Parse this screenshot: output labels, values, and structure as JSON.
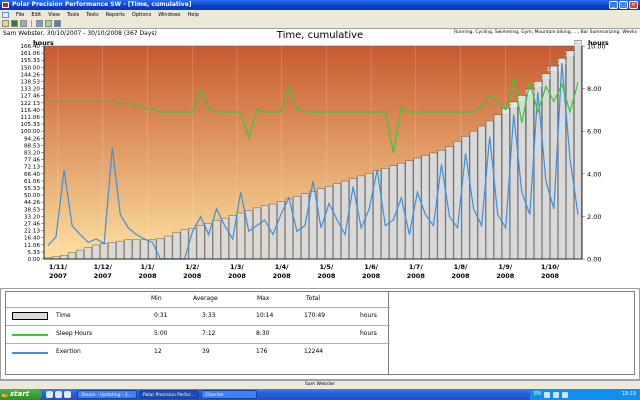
{
  "window": {
    "title": "Polar Precision Performance SW - [Time, cumulative]",
    "controls": [
      "_",
      "□",
      "×"
    ]
  },
  "menu": [
    "File",
    "Edit",
    "View",
    "Tools",
    "Tests",
    "Reports",
    "Options",
    "Windows",
    "Help"
  ],
  "chart_header": {
    "user_range": "Sam Webster, 30/10/2007 - 30/10/2008 (367 Days)",
    "title": "Time, cumulative",
    "sports": "Running, Cycling, Swimming, Gym, Mountain biking, ..., Bar Summarizing: Weeks",
    "left_axis_label": "hours",
    "right_axis_label": "hours"
  },
  "chart_data": {
    "type": "bar",
    "title": "Time, cumulative",
    "left_axis": {
      "label": "hours",
      "ticks": [
        "0.00",
        "5.33",
        "11.06",
        "16.40",
        "22.13",
        "27.46",
        "33.20",
        "38.53",
        "44.26",
        "50.00",
        "55.33",
        "61.06",
        "66.40",
        "72.13",
        "77.46",
        "83.20",
        "88.53",
        "94.26",
        "100.00",
        "105.33",
        "111.06",
        "116.40",
        "122.13",
        "127.46",
        "133.20",
        "138.53",
        "144.26",
        "150.00",
        "155.33",
        "161.06",
        "166.40"
      ],
      "range": [
        0,
        166.67
      ]
    },
    "right_axis": {
      "label": "hours",
      "ticks": [
        "0.00",
        "2.00",
        "4.00",
        "6.00",
        "8.00",
        "10.00"
      ],
      "range": [
        0,
        10
      ]
    },
    "x_ticks": [
      {
        "month": "1/11/",
        "year": "2007"
      },
      {
        "month": "1/12/",
        "year": "2007"
      },
      {
        "month": "1/1/",
        "year": "2008"
      },
      {
        "month": "1/2/",
        "year": "2008"
      },
      {
        "month": "1/3/",
        "year": "2008"
      },
      {
        "month": "1/4/",
        "year": "2008"
      },
      {
        "month": "1/5/",
        "year": "2008"
      },
      {
        "month": "1/6/",
        "year": "2008"
      },
      {
        "month": "1/7/",
        "year": "2008"
      },
      {
        "month": "1/8/",
        "year": "2008"
      },
      {
        "month": "1/9/",
        "year": "2008"
      },
      {
        "month": "1/10/",
        "year": "2008"
      }
    ],
    "series": [
      {
        "name": "Time",
        "unit": "hours",
        "values": [
          1,
          2,
          3,
          5,
          7,
          9,
          11,
          12,
          13,
          14,
          15,
          15,
          15,
          15,
          16,
          18,
          21,
          23,
          24,
          26,
          28,
          30,
          32,
          34,
          36,
          38,
          40,
          42,
          43,
          45,
          47,
          49,
          51,
          53,
          55,
          57,
          59,
          61,
          63,
          65,
          67,
          69,
          71,
          73,
          75,
          77,
          79,
          81,
          83,
          85,
          88,
          92,
          96,
          100,
          104,
          108,
          113,
          118,
          123,
          128,
          133,
          139,
          145,
          151,
          157,
          163,
          171
        ],
        "labels_shown": [
          "98",
          "105",
          "112",
          "120",
          "126",
          "131",
          "143.5",
          "151",
          "162",
          "170"
        ]
      },
      {
        "name": "Sleep Hours",
        "unit": "hours",
        "values": [
          7.4,
          7.4,
          7.4,
          7.4,
          7.4,
          7.4,
          7.4,
          7.4,
          7.4,
          7.3,
          7.3,
          7.2,
          7.1,
          7.0,
          6.9,
          6.9,
          6.9,
          6.9,
          6.9,
          7.9,
          7.1,
          6.9,
          6.9,
          6.9,
          6.9,
          5.7,
          7.0,
          6.9,
          6.9,
          6.9,
          8.1,
          7.0,
          6.9,
          6.9,
          6.9,
          6.9,
          6.9,
          6.9,
          6.9,
          6.9,
          6.9,
          6.9,
          6.9,
          5.0,
          7.1,
          6.9,
          6.9,
          6.9,
          6.9,
          6.9,
          6.9,
          6.9,
          6.9,
          6.9,
          7.2,
          7.7,
          7.4,
          7.0,
          8.5,
          6.4,
          8.3,
          6.9,
          8.1,
          7.4,
          8.2,
          6.9,
          8.3
        ]
      },
      {
        "name": "Exertion",
        "unit": "index",
        "values": [
          12,
          20,
          80,
          30,
          22,
          15,
          18,
          14,
          100,
          40,
          28,
          22,
          18,
          15,
          0,
          0,
          0,
          0,
          25,
          38,
          22,
          45,
          30,
          18,
          60,
          25,
          30,
          35,
          22,
          40,
          55,
          25,
          30,
          70,
          28,
          50,
          35,
          22,
          65,
          28,
          45,
          80,
          30,
          35,
          55,
          22,
          60,
          40,
          30,
          85,
          38,
          28,
          95,
          45,
          30,
          110,
          40,
          28,
          130,
          60,
          40,
          150,
          70,
          45,
          176,
          90,
          40
        ]
      }
    ]
  },
  "legend": {
    "headers": {
      "min": "Min",
      "average": "Average",
      "max": "Max",
      "total": "Total"
    },
    "rows": [
      {
        "name": "Time",
        "min": "0:31",
        "average": "3:33",
        "max": "10:14",
        "total": "170:49",
        "unit": "hours",
        "color": "#d9d9d9"
      },
      {
        "name": "Sleep Hours",
        "min": "5:00",
        "average": "7:12",
        "max": "8:30",
        "total": "",
        "unit": "hours",
        "color": "#33cc33"
      },
      {
        "name": "Exertion",
        "min": "12",
        "average": "39",
        "max": "176",
        "total": "12244",
        "unit": "",
        "color": "#3d8fe0"
      }
    ]
  },
  "status": {
    "text": "Sam Webster"
  },
  "taskbar": {
    "start_label": "start",
    "tasks": [
      {
        "label": "Steam - Updating - 1...",
        "active": false
      },
      {
        "label": "Polar Precision Perfor...",
        "active": true
      },
      {
        "label": "2Xwriter",
        "active": false
      }
    ],
    "tray_lang": "EN",
    "clock": "19:19"
  },
  "colors": {
    "bg_top": "#c75a2e",
    "bg_bottom": "#fde1a0",
    "time_bar": "#d9d9d9",
    "sleep_line": "#33cc33",
    "exertion_line": "#3d8fe0"
  }
}
